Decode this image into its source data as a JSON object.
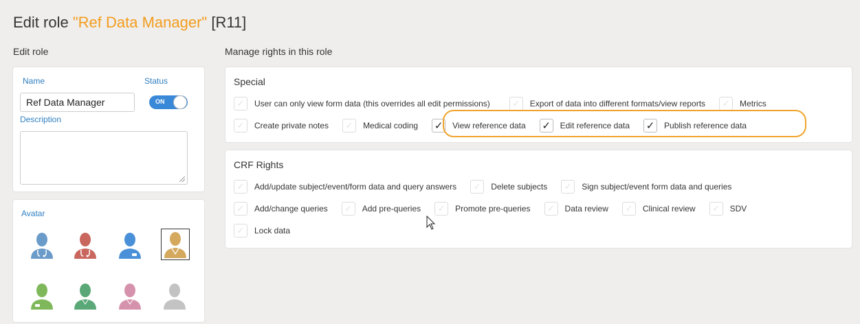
{
  "page": {
    "title_prefix": "Edit role ",
    "title_role": "\"Ref Data Manager\"",
    "title_suffix": " [R11]"
  },
  "left": {
    "section_label": "Edit role",
    "name_label": "Name",
    "status_label": "Status",
    "name_value": "Ref Data Manager",
    "status_toggle": "ON",
    "description_label": "Description",
    "description_value": "",
    "avatar_label": "Avatar",
    "avatars": [
      {
        "name": "doctor-blue",
        "color": "#6b9bc9"
      },
      {
        "name": "doctor-red",
        "color": "#c9675e"
      },
      {
        "name": "staff-blue",
        "color": "#4a90d9"
      },
      {
        "name": "manager-gold",
        "color": "#d4a95e",
        "selected": true
      },
      {
        "name": "staff-green",
        "color": "#7fb85a"
      },
      {
        "name": "person-green",
        "color": "#5aa877"
      },
      {
        "name": "person-pink",
        "color": "#d692ac"
      },
      {
        "name": "person-gray",
        "color": "#c3c3c3"
      }
    ]
  },
  "right": {
    "section_label": "Manage rights in this role",
    "special": {
      "title": "Special",
      "row1": [
        {
          "label": "User can only view form data (this overrides all edit permissions)",
          "checked": false
        },
        {
          "label": "Export of data into different formats/view reports",
          "checked": false
        },
        {
          "label": "Metrics",
          "checked": false
        }
      ],
      "row2": [
        {
          "label": "Create private notes",
          "checked": false
        },
        {
          "label": "Medical coding",
          "checked": false
        },
        {
          "label": "View reference data",
          "checked": true
        },
        {
          "label": "Edit reference data",
          "checked": true
        },
        {
          "label": "Publish reference data",
          "checked": true
        }
      ]
    },
    "crf": {
      "title": "CRF Rights",
      "row1": [
        {
          "label": "Add/update subject/event/form data and query answers",
          "checked": false
        },
        {
          "label": "Delete subjects",
          "checked": false
        },
        {
          "label": "Sign subject/event form data and queries",
          "checked": false
        }
      ],
      "row2": [
        {
          "label": "Add/change queries",
          "checked": false
        },
        {
          "label": "Add pre-queries",
          "checked": false
        },
        {
          "label": "Promote pre-queries",
          "checked": false
        },
        {
          "label": "Data review",
          "checked": false
        },
        {
          "label": "Clinical review",
          "checked": false
        },
        {
          "label": "SDV",
          "checked": false
        }
      ],
      "row3": [
        {
          "label": "Lock data",
          "checked": false
        }
      ]
    }
  },
  "colors": {
    "accent": "#f39c1d",
    "link_blue": "#2f7fc1",
    "toggle_blue": "#3a88d8",
    "highlight_orange": "#f0a32a"
  }
}
